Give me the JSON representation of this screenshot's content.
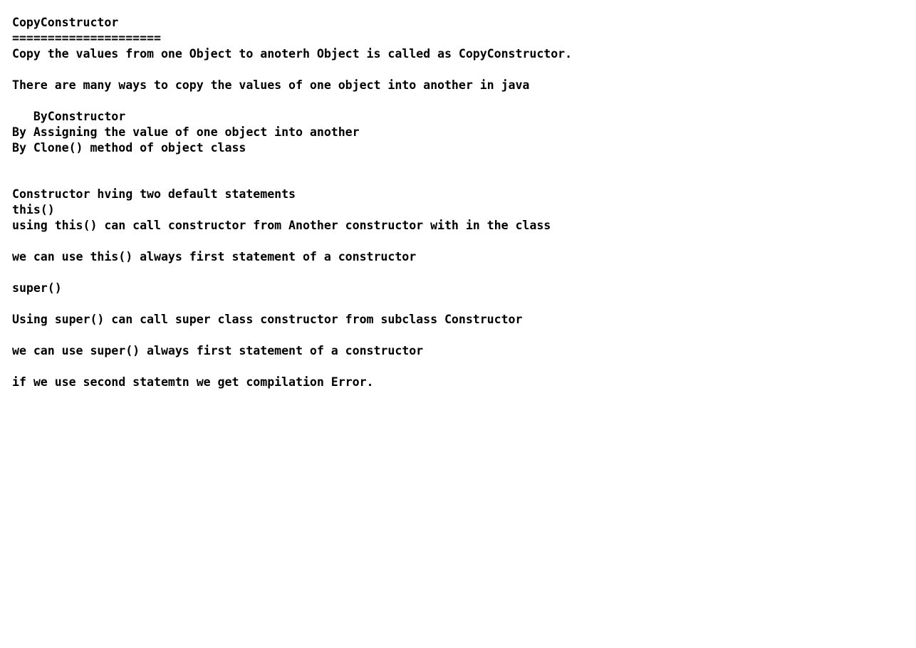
{
  "document": {
    "title": "CopyConstructor",
    "underline": "=====================",
    "definition": "Copy the values from one Object to anoterh Object is called as CopyConstructor.",
    "ways_intro": "There are many ways to copy the values of one object into another in java",
    "ways": [
      "   ByConstructor",
      "By Assigning the value of one object into another",
      "By Clone() method of object class"
    ],
    "constructor_intro": "Constructor hving two default statements",
    "this_heading": "this()",
    "this_desc": "using this() can call constructor from Another constructor with in the class",
    "this_rule": "we can use this() always first statement of a constructor",
    "super_heading": "super()",
    "super_desc": "Using super() can call super class constructor from subclass Constructor",
    "super_rule": "we can use super() always first statement of a constructor",
    "error_note": "if we use second statemtn we get compilation Error."
  }
}
